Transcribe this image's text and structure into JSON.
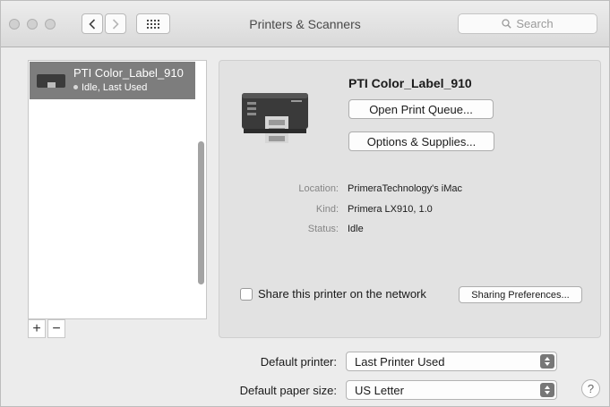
{
  "window": {
    "title": "Printers & Scanners"
  },
  "toolbar": {
    "search_placeholder": "Search",
    "icons": {
      "back": "chevron-left-icon",
      "forward": "chevron-right-icon",
      "grid": "grid-icon",
      "search": "search-icon"
    }
  },
  "printer_list": {
    "items": [
      {
        "name": "PTI Color_Label_910",
        "status": "Idle, Last Used",
        "selected": true
      }
    ],
    "add_label": "+",
    "remove_label": "−"
  },
  "detail": {
    "printer_name": "PTI Color_Label_910",
    "open_queue_label": "Open Print Queue...",
    "options_label": "Options & Supplies...",
    "location_label": "Location:",
    "location_value": "PrimeraTechnology's iMac",
    "kind_label": "Kind:",
    "kind_value": "Primera LX910, 1.0",
    "status_label": "Status:",
    "status_value": "Idle",
    "share_label": "Share this printer on the network",
    "share_checked": false,
    "sharing_prefs_label": "Sharing Preferences..."
  },
  "defaults": {
    "printer_label": "Default printer:",
    "printer_value": "Last Printer Used",
    "paper_label": "Default paper size:",
    "paper_value": "US Letter",
    "help_label": "?"
  },
  "colors": {
    "selection": "#7d7d7d",
    "panel": "#e2e2e2",
    "window": "#ececec"
  }
}
